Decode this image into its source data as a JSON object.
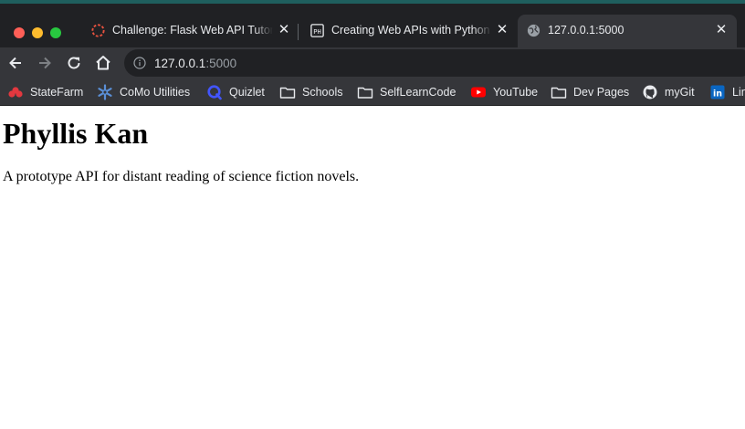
{
  "browser": {
    "tabs": [
      {
        "title": "Challenge: Flask Web API Tutorial",
        "icon": "spinner-icon",
        "active": false
      },
      {
        "title": "Creating Web APIs with Python and Flask",
        "icon": "programming-historian-icon",
        "active": false
      },
      {
        "title": "127.0.0.1:5000",
        "icon": "globe-icon",
        "active": true
      }
    ],
    "address": {
      "host": "127.0.0.1",
      "port": ":5000"
    },
    "bookmarks": [
      {
        "label": "StateFarm",
        "icon": "statefarm-icon"
      },
      {
        "label": "CoMo Utilities",
        "icon": "snowflake-icon"
      },
      {
        "label": "Quizlet",
        "icon": "quizlet-icon"
      },
      {
        "label": "Schools",
        "icon": "folder-icon"
      },
      {
        "label": "SelfLearnCode",
        "icon": "folder-icon"
      },
      {
        "label": "YouTube",
        "icon": "youtube-icon"
      },
      {
        "label": "Dev Pages",
        "icon": "folder-icon"
      },
      {
        "label": "myGit",
        "icon": "github-icon"
      },
      {
        "label": "LinkedIn",
        "icon": "linkedin-icon"
      }
    ]
  },
  "page": {
    "heading": "Phyllis Kan",
    "description": "A prototype API for distant reading of science fiction novels."
  },
  "colors": {
    "tabbar": "#202124",
    "toolbar": "#35363a",
    "text_light": "#e8eaed",
    "close_red": "#ff5f57",
    "minimize_yellow": "#febc2e",
    "maximize_green": "#28c840"
  }
}
